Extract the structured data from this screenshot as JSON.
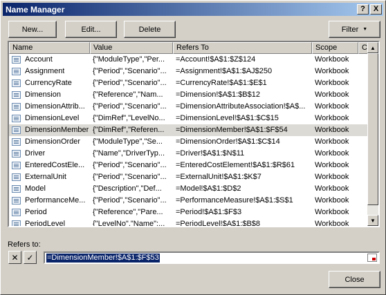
{
  "window": {
    "title": "Name Manager",
    "help_label": "?",
    "close_label": "X"
  },
  "toolbar": {
    "new_label": "New...",
    "edit_label": "Edit...",
    "delete_label": "Delete",
    "filter_label": "Filter",
    "filter_arrow": "▼"
  },
  "columns": [
    "Name",
    "Value",
    "Refers To",
    "Scope",
    "Co"
  ],
  "rows": [
    {
      "name": "Account",
      "value": "{\"ModuleType\",\"Per...",
      "refers": "=Account!$A$1:$Z$124",
      "scope": "Workbook"
    },
    {
      "name": "Assignment",
      "value": "{\"Period\",\"Scenario\"...",
      "refers": "=Assignment!$A$1:$AJ$250",
      "scope": "Workbook"
    },
    {
      "name": "CurrencyRate",
      "value": "{\"Period\",\"Scenario\"...",
      "refers": "=CurrencyRate!$A$1:$E$1",
      "scope": "Workbook"
    },
    {
      "name": "Dimension",
      "value": "{\"Reference\",\"Nam...",
      "refers": "=Dimension!$A$1:$B$12",
      "scope": "Workbook"
    },
    {
      "name": "DimensionAttrib...",
      "value": "{\"Period\",\"Scenario\"...",
      "refers": "=DimensionAttributeAssociation!$A$...",
      "scope": "Workbook"
    },
    {
      "name": "DimensionLevel",
      "value": "{\"DimRef\",\"LevelNo...",
      "refers": "=DimensionLevel!$A$1:$C$15",
      "scope": "Workbook"
    },
    {
      "name": "DimensionMember",
      "value": "{\"DimRef\",\"Referen...",
      "refers": "=DimensionMember!$A$1:$F$54",
      "scope": "Workbook",
      "selected": true
    },
    {
      "name": "DimensionOrder",
      "value": "{\"ModuleType\",\"Se...",
      "refers": "=DimensionOrder!$A$1:$C$14",
      "scope": "Workbook"
    },
    {
      "name": "Driver",
      "value": "{\"Name\",\"DriverTyp...",
      "refers": "=Driver!$A$1:$N$11",
      "scope": "Workbook"
    },
    {
      "name": "EnteredCostEle...",
      "value": "{\"Period\",\"Scenario\"...",
      "refers": "=EnteredCostElement!$A$1:$R$61",
      "scope": "Workbook"
    },
    {
      "name": "ExternalUnit",
      "value": "{\"Period\",\"Scenario\"...",
      "refers": "=ExternalUnit!$A$1:$K$7",
      "scope": "Workbook"
    },
    {
      "name": "Model",
      "value": "{\"Description\",\"Def...",
      "refers": "=Model!$A$1:$D$2",
      "scope": "Workbook"
    },
    {
      "name": "PerformanceMe...",
      "value": "{\"Period\",\"Scenario\"...",
      "refers": "=PerformanceMeasure!$A$1:$S$1",
      "scope": "Workbook"
    },
    {
      "name": "Period",
      "value": "{\"Reference\",\"Pare...",
      "refers": "=Period!$A$1:$F$3",
      "scope": "Workbook"
    },
    {
      "name": "PeriodLevel",
      "value": "{\"LevelNo\",\"Name\";...",
      "refers": "=PeriodLevel!$A$1:$B$8",
      "scope": "Workbook"
    }
  ],
  "refers_to": {
    "label": "Refers to:",
    "value": "=DimensionMember!$A$1:$F$53",
    "cancel_glyph": "✕",
    "confirm_glyph": "✓"
  },
  "footer": {
    "close_label": "Close"
  }
}
